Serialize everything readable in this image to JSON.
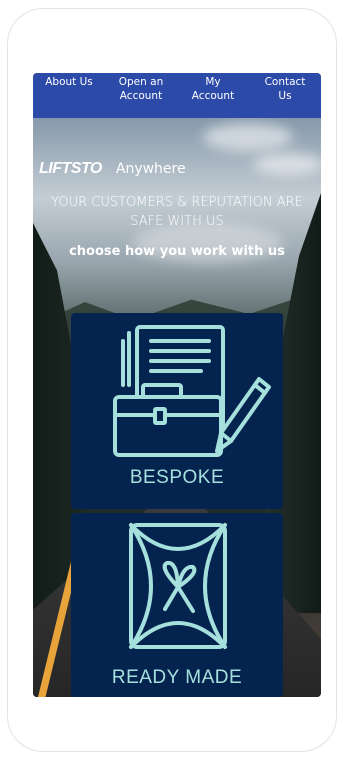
{
  "nav": {
    "items": [
      {
        "label": "About Us"
      },
      {
        "label": "Open an Account"
      },
      {
        "label": "My Account"
      },
      {
        "label": "Contact Us"
      }
    ]
  },
  "brand": {
    "logo_text": "LIFTSTO",
    "tagline": "Anywhere"
  },
  "hero": {
    "headline": "YOUR CUSTOMERS & REPUTATION ARE SAFE WITH US",
    "subhead": "choose how you work with us"
  },
  "options": [
    {
      "label": "BESPOKE",
      "icon": "briefcase-documents-pen-icon"
    },
    {
      "label": "READY MADE",
      "icon": "gift-package-icon"
    }
  ],
  "colors": {
    "nav_bg": "#2c4aa8",
    "card_bg": "#04244f",
    "icon_color": "#a6e0dc"
  }
}
